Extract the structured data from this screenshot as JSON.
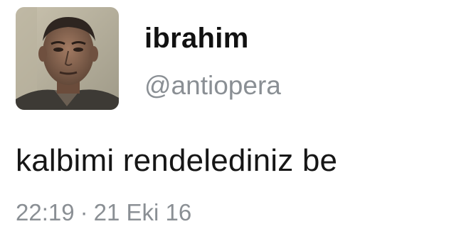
{
  "user": {
    "display_name": "ibrahim",
    "handle": "@antiopera",
    "avatar": "profile-photo"
  },
  "tweet": {
    "text": "kalbimi rendelediniz be",
    "time": "22:19",
    "separator": "·",
    "date": "21 Eki 16"
  },
  "colors": {
    "name": "#111111",
    "handle": "#8a8f94",
    "text": "#161616",
    "meta": "#8a8f94",
    "background": "#ffffff"
  }
}
